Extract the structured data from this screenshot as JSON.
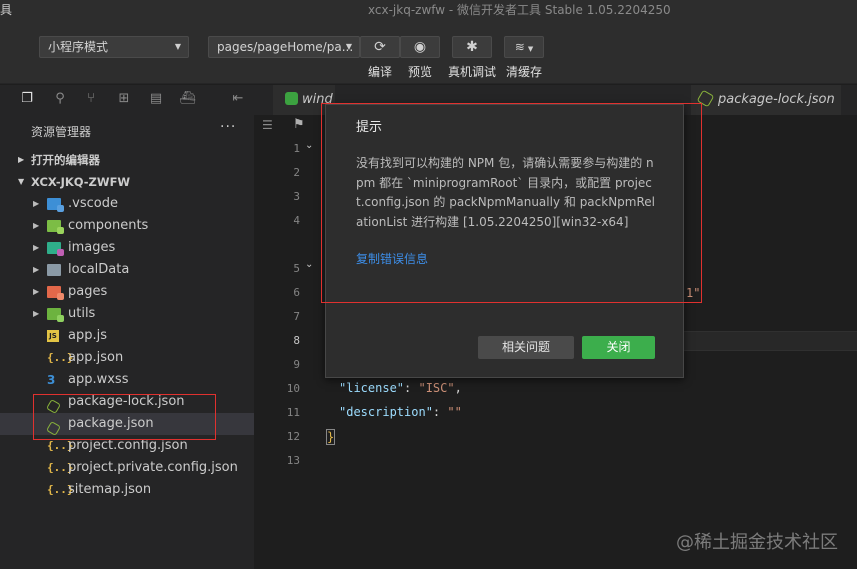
{
  "titlebar": {
    "menu": "具",
    "title": "xcx-jkq-zwfw - 微信开发者工具 Stable 1.05.2204250"
  },
  "toolbar": {
    "mode": "小程序模式",
    "page_path": "pages/pageHome/pa...",
    "compile_label": "编译",
    "preview_label": "预览",
    "debug_label": "真机调试",
    "clear_cache_label": "清缓存"
  },
  "tabs": [
    {
      "label": "wind"
    },
    {
      "label": "package-lock.json"
    }
  ],
  "sidebar": {
    "header": "资源管理器",
    "more": "···",
    "open_editors": "打开的编辑器",
    "project": "XCX-JKQ-ZWFW",
    "items": [
      {
        "label": ".vscode",
        "type": "folder",
        "color": "#3d8fd6",
        "badge": "#5aa0e0"
      },
      {
        "label": "components",
        "type": "folder",
        "color": "#7cbd45",
        "badge": "#9bd45d"
      },
      {
        "label": "images",
        "type": "folder",
        "color": "#2fae8a",
        "badge": "#c05fb4"
      },
      {
        "label": "localData",
        "type": "folder",
        "color": "#8b9aa6",
        "badge": ""
      },
      {
        "label": "pages",
        "type": "folder",
        "color": "#e3684a",
        "badge": "#f08a6a"
      },
      {
        "label": "utils",
        "type": "folder",
        "color": "#6db33f",
        "badge": "#8fd060"
      },
      {
        "label": "app.js",
        "type": "js"
      },
      {
        "label": "app.json",
        "type": "brace"
      },
      {
        "label": "app.wxss",
        "type": "css"
      },
      {
        "label": "package-lock.json",
        "type": "jsonfile"
      },
      {
        "label": "package.json",
        "type": "jsonfile"
      },
      {
        "label": "project.config.json",
        "type": "brace"
      },
      {
        "label": "project.private.config.json",
        "type": "brace"
      },
      {
        "label": "sitemap.json",
        "type": "brace"
      }
    ]
  },
  "editor": {
    "line_numbers": [
      "1",
      "2",
      "3",
      "4",
      "5",
      "6",
      "7",
      "8",
      "9",
      "10",
      "11",
      "12",
      "13"
    ],
    "current_line": "8",
    "lines": {
      "l7_tail": "1\"",
      "l10_key": "\"license\"",
      "l10_val": "\"ISC\"",
      "l11_key": "\"description\"",
      "l11_val": "\"\"",
      "l12": "}"
    }
  },
  "dialog": {
    "title": "提示",
    "message": "没有找到可以构建的 NPM 包，请确认需要参与构建的 npm 都在 `miniprogramRoot` 目录内，或配置 project.config.json 的 packNpmManually 和 packNpmRelationList 进行构建 [1.05.2204250][win32-x64]",
    "copy_link": "复制错误信息",
    "related_button": "相关问题",
    "close_button": "关闭"
  },
  "watermark": "@稀土掘金技术社区",
  "colors": {
    "accent_green": "#3cae4c",
    "link_blue": "#3d8ee8",
    "highlight_red": "#e0312f"
  }
}
